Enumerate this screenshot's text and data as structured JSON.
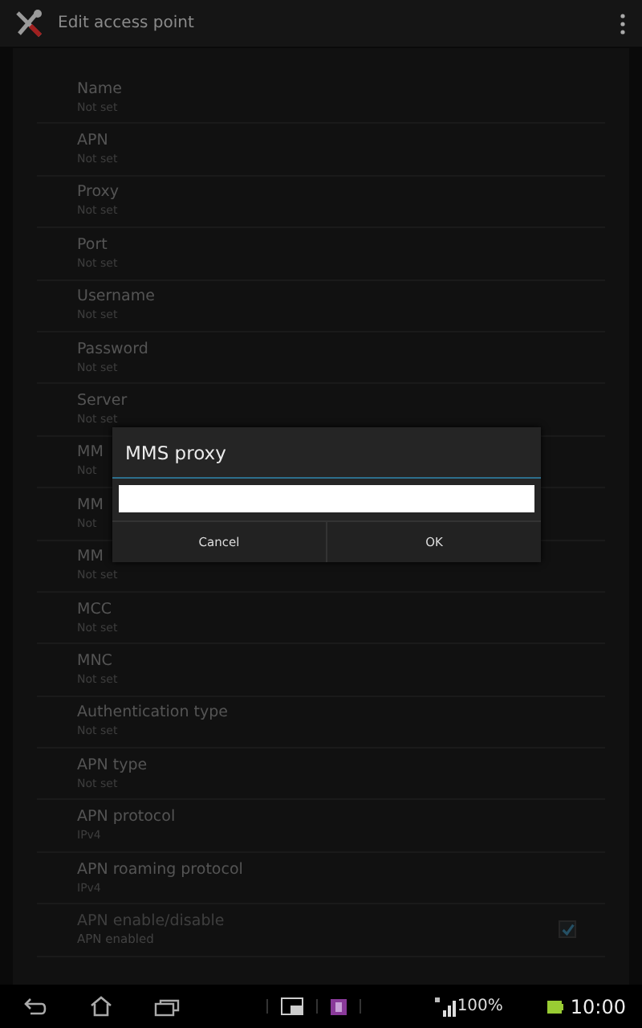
{
  "action_bar": {
    "title": "Edit access point"
  },
  "settings": [
    {
      "kind": "text",
      "title": "Name",
      "summary": "Not set"
    },
    {
      "kind": "text",
      "title": "APN",
      "summary": "Not set"
    },
    {
      "kind": "text",
      "title": "Proxy",
      "summary": "Not set"
    },
    {
      "kind": "text",
      "title": "Port",
      "summary": "Not set"
    },
    {
      "kind": "text",
      "title": "Username",
      "summary": "Not set"
    },
    {
      "kind": "text",
      "title": "Password",
      "summary": "Not set"
    },
    {
      "kind": "text",
      "title": "Server",
      "summary": "Not set"
    },
    {
      "kind": "text",
      "title": "MM",
      "summary": "Not"
    },
    {
      "kind": "text",
      "title": "MM",
      "summary": "Not"
    },
    {
      "kind": "text",
      "title": "MM",
      "summary": "Not set"
    },
    {
      "kind": "text",
      "title": "MCC",
      "summary": "Not set"
    },
    {
      "kind": "text",
      "title": "MNC",
      "summary": "Not set"
    },
    {
      "kind": "text",
      "title": "Authentication type",
      "summary": "Not set"
    },
    {
      "kind": "text",
      "title": "APN type",
      "summary": "Not set"
    },
    {
      "kind": "text",
      "title": "APN protocol",
      "summary": "IPv4"
    },
    {
      "kind": "text",
      "title": "APN roaming protocol",
      "summary": "IPv4"
    },
    {
      "kind": "checkbox",
      "title": "APN enable/disable",
      "summary": "APN enabled",
      "checked": true,
      "disabled": true
    }
  ],
  "dialog": {
    "title": "MMS proxy",
    "buttons": [
      "Cancel",
      "OK"
    ]
  },
  "status_bar": {
    "battery": "100%",
    "time": "10:00"
  }
}
